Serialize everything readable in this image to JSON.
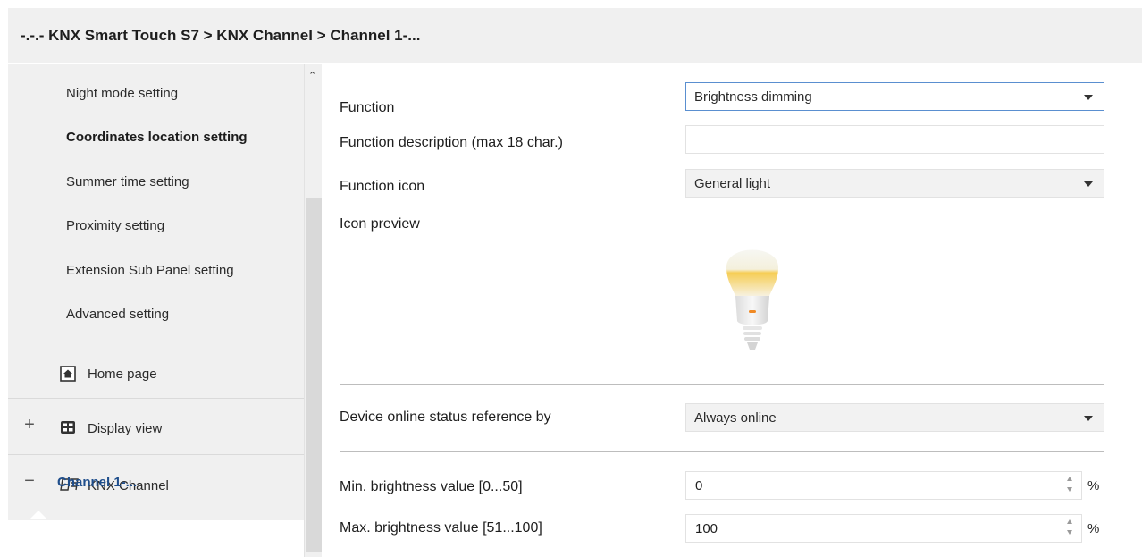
{
  "header": {
    "breadcrumb": "-.-.- KNX Smart Touch S7 > KNX Channel  > Channel 1-..."
  },
  "sidebar": {
    "items": [
      {
        "label": "Night mode setting"
      },
      {
        "label": "Coordinates location setting"
      },
      {
        "label": "Summer time setting"
      },
      {
        "label": "Proximity setting"
      },
      {
        "label": "Extension Sub Panel setting"
      },
      {
        "label": "Advanced setting"
      }
    ],
    "home_page": {
      "label": "Home page",
      "icon": "home-icon"
    },
    "display_view": {
      "label": "Display view",
      "icon": "grid-icon",
      "toggle": "+"
    },
    "knx_channel": {
      "label": "KNX Channel",
      "icon": "channel-icon",
      "toggle": "−"
    },
    "selected": {
      "label": "Channel 1-..."
    }
  },
  "params": {
    "function": {
      "label": "Function",
      "value": "Brightness dimming"
    },
    "description": {
      "label": "Function description (max 18 char.)",
      "value": ""
    },
    "icon": {
      "label": "Function icon",
      "value": "General light"
    },
    "preview": {
      "label": "Icon preview",
      "icon": "light-bulb-icon"
    },
    "online_status": {
      "label": "Device online status reference by",
      "value": "Always online"
    },
    "min_brightness": {
      "label": "Min. brightness value [0...50]",
      "value": "0",
      "unit": "%"
    },
    "max_brightness": {
      "label": "Max. brightness value [51...100]",
      "value": "100",
      "unit": "%"
    }
  },
  "colors": {
    "accent_blue": "#1f4e8c",
    "focus_border": "#5a8fd0",
    "panel_bg": "#f0f0f0"
  }
}
